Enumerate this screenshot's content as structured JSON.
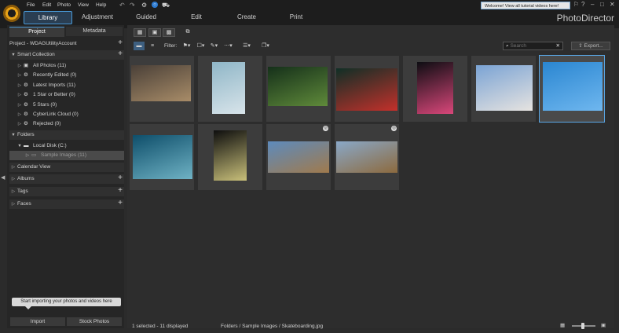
{
  "app": {
    "brand": "PhotoDirector",
    "menu": [
      "File",
      "Edit",
      "Photo",
      "View",
      "Help"
    ],
    "welcome": "Welcome! View all tutorial videos here!",
    "modes": [
      "Library",
      "Adjustment",
      "Guided",
      "Edit",
      "Create",
      "Print"
    ],
    "accent": "#4a9bd9"
  },
  "left_panel": {
    "tabs": [
      "Project",
      "Metadata"
    ],
    "project": "Project - WDAGUtilityAccount",
    "smart_collection": {
      "label": "Smart Collection",
      "items": [
        {
          "label": "All Photos (11)",
          "icon": "photos-icon"
        },
        {
          "label": "Recently Edited (0)",
          "icon": "smart-collection-icon"
        },
        {
          "label": "Latest Imports (11)",
          "icon": "smart-collection-icon"
        },
        {
          "label": "1 Star or Better (0)",
          "icon": "smart-collection-icon"
        },
        {
          "label": "5 Stars (0)",
          "icon": "smart-collection-icon"
        },
        {
          "label": "CyberLink Cloud (0)",
          "icon": "smart-collection-icon"
        },
        {
          "label": "Rejected (0)",
          "icon": "smart-collection-icon"
        }
      ]
    },
    "folders": {
      "label": "Folders",
      "disk": "Local Disk (C:)",
      "selected": "Sample Images (11)"
    },
    "calendar": "Calendar View",
    "albums": "Albums",
    "tags": "Tags",
    "faces": "Faces",
    "import_tip": "Start importing your photos and videos here",
    "import_button": "Import",
    "stock_button": "Stock Photos"
  },
  "toolbar": {
    "filter_label": "Filter:",
    "search_placeholder": "Search",
    "export_label": "Export..."
  },
  "photos": [
    {
      "name": "basketball-dunk",
      "colors": [
        "#4a4038",
        "#a88c68"
      ]
    },
    {
      "name": "rock-boat",
      "colors": [
        "#8fb6c7",
        "#d8e4ea"
      ]
    },
    {
      "name": "forest",
      "colors": [
        "#15301a",
        "#5f8a3a"
      ]
    },
    {
      "name": "red-leaf",
      "colors": [
        "#0f2f26",
        "#c4302b"
      ]
    },
    {
      "name": "neon-sign",
      "colors": [
        "#0d0d12",
        "#d9477a"
      ]
    },
    {
      "name": "rocket-launch",
      "colors": [
        "#7aa3d4",
        "#e6e3e0"
      ]
    },
    {
      "name": "skateboarding",
      "colors": [
        "#2a86d1",
        "#6fb7ef"
      ],
      "selected": true
    },
    {
      "name": "wave",
      "colors": [
        "#0e4e6a",
        "#6fb2c4"
      ]
    },
    {
      "name": "window-light",
      "colors": [
        "#0e0e0e",
        "#c9c07a"
      ]
    },
    {
      "name": "panorama-1",
      "colors": [
        "#5d8bbd",
        "#a07a4c"
      ],
      "badge": true
    },
    {
      "name": "panorama-2",
      "colors": [
        "#8aa8c8",
        "#8c6a3e"
      ],
      "badge": true
    }
  ],
  "status": {
    "selection": "1 selected - 11 displayed",
    "path": "Folders / Sample Images / Skateboarding.jpg",
    "zoom": 0.45
  }
}
